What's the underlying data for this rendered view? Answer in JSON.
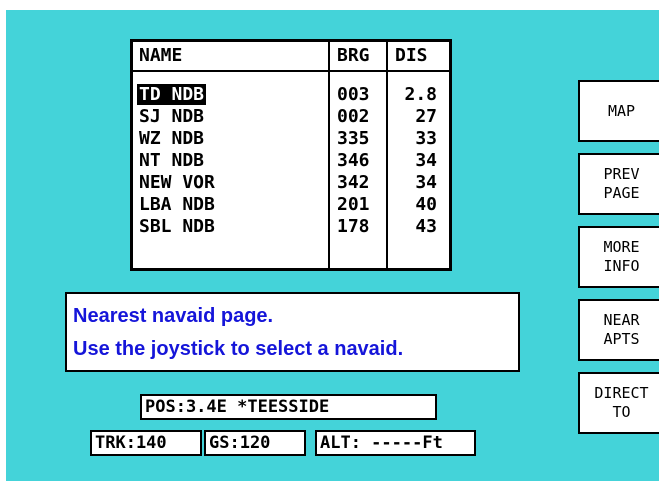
{
  "table": {
    "headers": {
      "name": "NAME",
      "brg": "BRG",
      "dis": "DIS"
    },
    "rows": [
      {
        "name": "TD NDB",
        "brg": "003",
        "dis": "2.8"
      },
      {
        "name": "SJ NDB",
        "brg": "002",
        "dis": "27"
      },
      {
        "name": "WZ NDB",
        "brg": "335",
        "dis": "33"
      },
      {
        "name": "NT NDB",
        "brg": "346",
        "dis": "34"
      },
      {
        "name": "NEW VOR",
        "brg": "342",
        "dis": "34"
      },
      {
        "name": "LBA NDB",
        "brg": "201",
        "dis": "40"
      },
      {
        "name": "SBL NDB",
        "brg": "178",
        "dis": "43"
      }
    ],
    "selected_index": 0
  },
  "help": {
    "line1": "Nearest navaid page.",
    "line2": "Use the joystick to select a navaid."
  },
  "buttons": {
    "map": {
      "line1": "MAP",
      "line2": ""
    },
    "prev_page": {
      "line1": "PREV",
      "line2": "PAGE"
    },
    "more_info": {
      "line1": "MORE",
      "line2": "INFO"
    },
    "near_apts": {
      "line1": "NEAR",
      "line2": "APTS"
    },
    "direct_to": {
      "line1": "DIRECT",
      "line2": "TO"
    }
  },
  "status": {
    "pos": "POS:3.4E *TEESSIDE",
    "trk": "TRK:140",
    "gs": "GS:120",
    "alt": "ALT: -----Ft"
  },
  "colors": {
    "screen_bg": "#44d3d9",
    "help_text": "#1515d9",
    "selection_bg": "#000000"
  }
}
